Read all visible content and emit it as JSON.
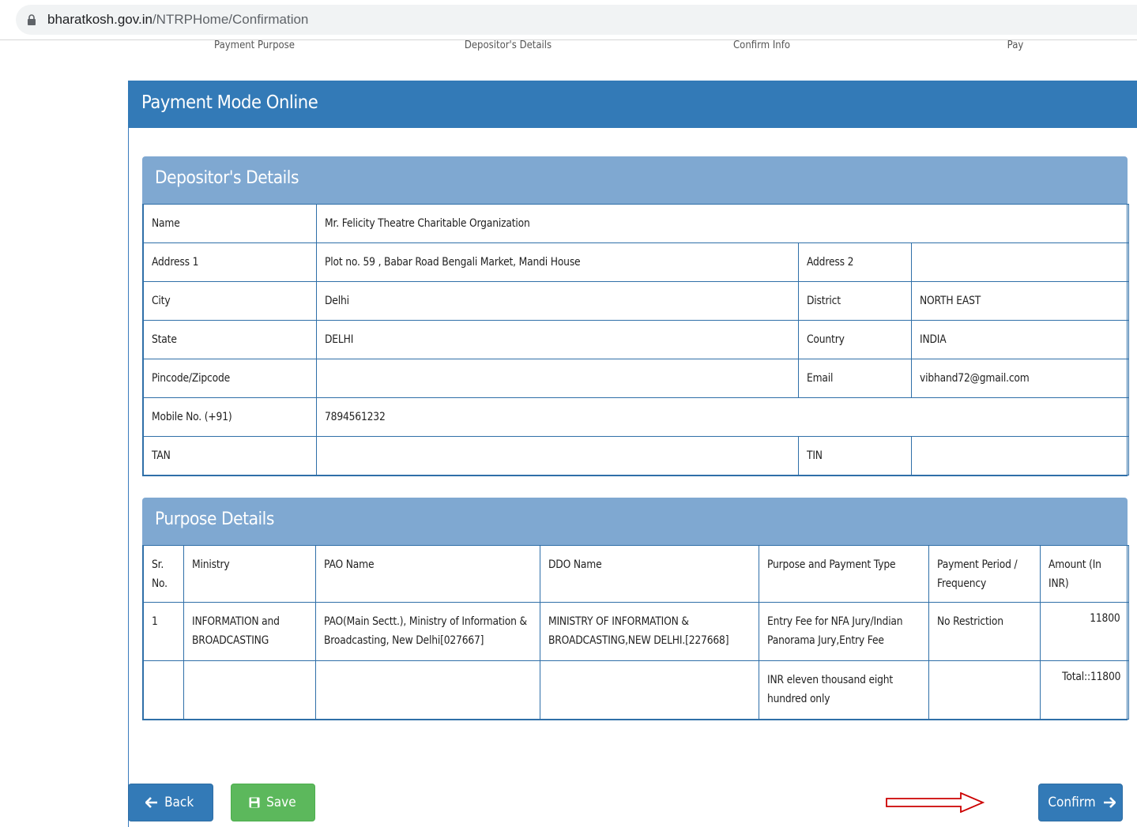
{
  "browser": {
    "url_host": "bharatkosh.gov.in",
    "url_path": "/NTRPHome/Confirmation"
  },
  "steps": [
    "Payment Purpose",
    "Depositor's Details",
    "Confirm Info",
    "Pay"
  ],
  "page": {
    "title": "Payment Mode Online"
  },
  "depositor": {
    "title": "Depositor's Details",
    "name_label": "Name",
    "name_value": "Mr. Felicity Theatre Charitable Organization",
    "address1_label": "Address 1",
    "address1_value": "Plot no. 59 , Babar Road Bengali Market, Mandi House",
    "address2_label": "Address 2",
    "address2_value": "",
    "city_label": "City",
    "city_value": "Delhi",
    "district_label": "District",
    "district_value": "NORTH EAST",
    "state_label": "State",
    "state_value": "DELHI",
    "country_label": "Country",
    "country_value": "INDIA",
    "pincode_label": "Pincode/Zipcode",
    "pincode_value": "",
    "email_label": "Email",
    "email_value": "vibhand72@gmail.com",
    "mobile_label": "Mobile No. (+91)",
    "mobile_value": "7894561232",
    "tan_label": "TAN",
    "tan_value": "",
    "tin_label": "TIN",
    "tin_value": ""
  },
  "purpose": {
    "title": "Purpose Details",
    "headers": {
      "sr": "Sr. No.",
      "ministry": "Ministry",
      "pao": "PAO Name",
      "ddo": "DDO Name",
      "purpose": "Purpose and Payment Type",
      "period": "Payment Period / Frequency",
      "amount": "Amount (In INR)"
    },
    "row": {
      "sr": "1",
      "ministry": "INFORMATION and BROADCASTING",
      "pao": "PAO(Main Sectt.), Ministry of Information & Broadcasting, New Delhi[027667]",
      "ddo": "MINISTRY OF INFORMATION & BROADCASTING,NEW DELHI.[227668]",
      "purpose": "Entry Fee for NFA Jury/Indian Panorama Jury,Entry Fee",
      "period": "No Restriction",
      "amount": "11800"
    },
    "total": {
      "words": "INR eleven thousand eight hundred only",
      "amount": "Total::11800"
    }
  },
  "buttons": {
    "back": "Back",
    "save": "Save",
    "confirm": "Confirm"
  },
  "colors": {
    "primary": "#337ab7",
    "panel_header": "#7fa8d1",
    "success": "#5cb85c",
    "annotation_arrow": "#cc0000"
  }
}
